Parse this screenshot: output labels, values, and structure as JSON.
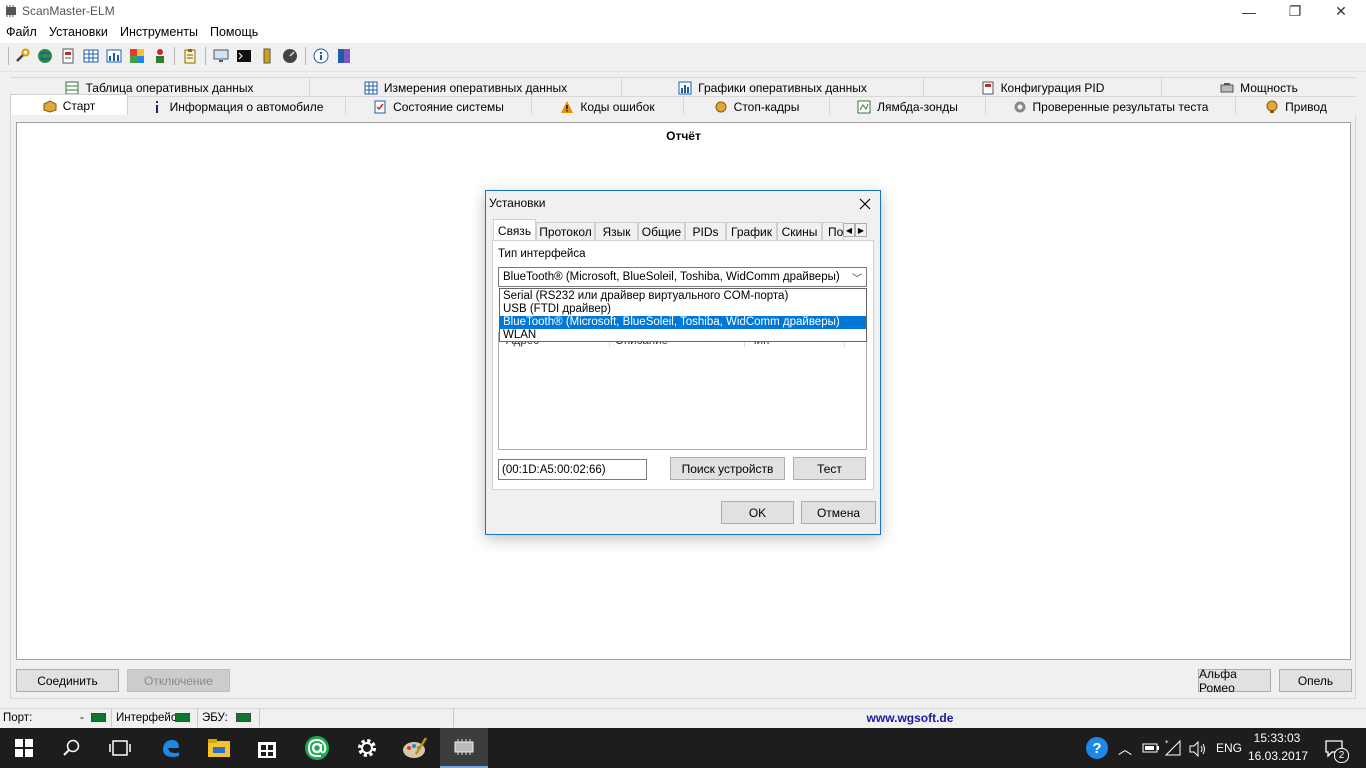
{
  "window": {
    "title": "ScanMaster-ELM",
    "controls": {
      "minimize": "—",
      "restore": "❐",
      "close": "✕"
    }
  },
  "menu": [
    "Файл",
    "Установки",
    "Инструменты",
    "Помощь"
  ],
  "toolbar_icons": [
    "wrench-icon",
    "globe-icon",
    "document-icon",
    "table-icon",
    "chart-icon",
    "colors-icon",
    "person-icon",
    "clipboard-icon",
    "monitor-icon",
    "terminal-icon",
    "battery-icon",
    "gauge-icon",
    "info-icon",
    "book-icon"
  ],
  "tabs_row1": [
    {
      "label": "Таблица оперативных данных",
      "icon": "table-icon"
    },
    {
      "label": "Измерения оперативных данных",
      "icon": "grid-icon"
    },
    {
      "label": "Графики оперативных данных",
      "icon": "chart-icon"
    },
    {
      "label": "Конфигурация PID",
      "icon": "document-icon"
    },
    {
      "label": "Мощность",
      "icon": "engine-icon"
    }
  ],
  "tabs_row2": [
    {
      "label": "Старт",
      "icon": "box-icon",
      "active": true
    },
    {
      "label": "Информация о автомобиле",
      "icon": "info-icon"
    },
    {
      "label": "Состояние системы",
      "icon": "checklist-icon"
    },
    {
      "label": "Коды ошибок",
      "icon": "warning-icon"
    },
    {
      "label": "Стоп-кадры",
      "icon": "camera-icon"
    },
    {
      "label": "Лямбда-зонды",
      "icon": "sensor-icon"
    },
    {
      "label": "Проверенные результаты теста",
      "icon": "gear-icon"
    },
    {
      "label": "Привод",
      "icon": "actuator-icon"
    }
  ],
  "report": {
    "title": "Отчёт"
  },
  "buttons": {
    "connect": "Соединить",
    "disconnect": "Отключение",
    "alfa": "Альфа Ромео",
    "opel": "Опель"
  },
  "status": {
    "port_label": "Порт:",
    "port_value": "-",
    "interface_label": "Интерфейс:",
    "ecu_label": "ЭБУ:",
    "website": "www.wgsoft.de"
  },
  "dialog": {
    "title": "Установки",
    "tabs": [
      "Связь",
      "Протокол",
      "Язык",
      "Общие",
      "PIDs",
      "График",
      "Скины",
      "По"
    ],
    "interface_label": "Тип интерфейса",
    "selected": "BlueTooth® (Microsoft, BlueSoleil, Toshiba, WidComm драйверы)",
    "options": [
      "Serial (RS232 или драйвер виртуального COM-порта)",
      "USB (FTDI драйвер)",
      "BlueTooth® (Microsoft, BlueSoleil, Toshiba, WidComm драйверы)",
      "WLAN"
    ],
    "selected_index": 2,
    "columns": [
      "Адрес",
      "Описание",
      "Чип"
    ],
    "address": "(00:1D:A5:00:02:66)",
    "search_button": "Поиск устройств",
    "test_button": "Тест",
    "ok_button": "OK",
    "cancel_button": "Отмена"
  },
  "taskbar": {
    "lang": "ENG",
    "time": "15:33:03",
    "date": "16.03.2017",
    "notifications": "2"
  }
}
